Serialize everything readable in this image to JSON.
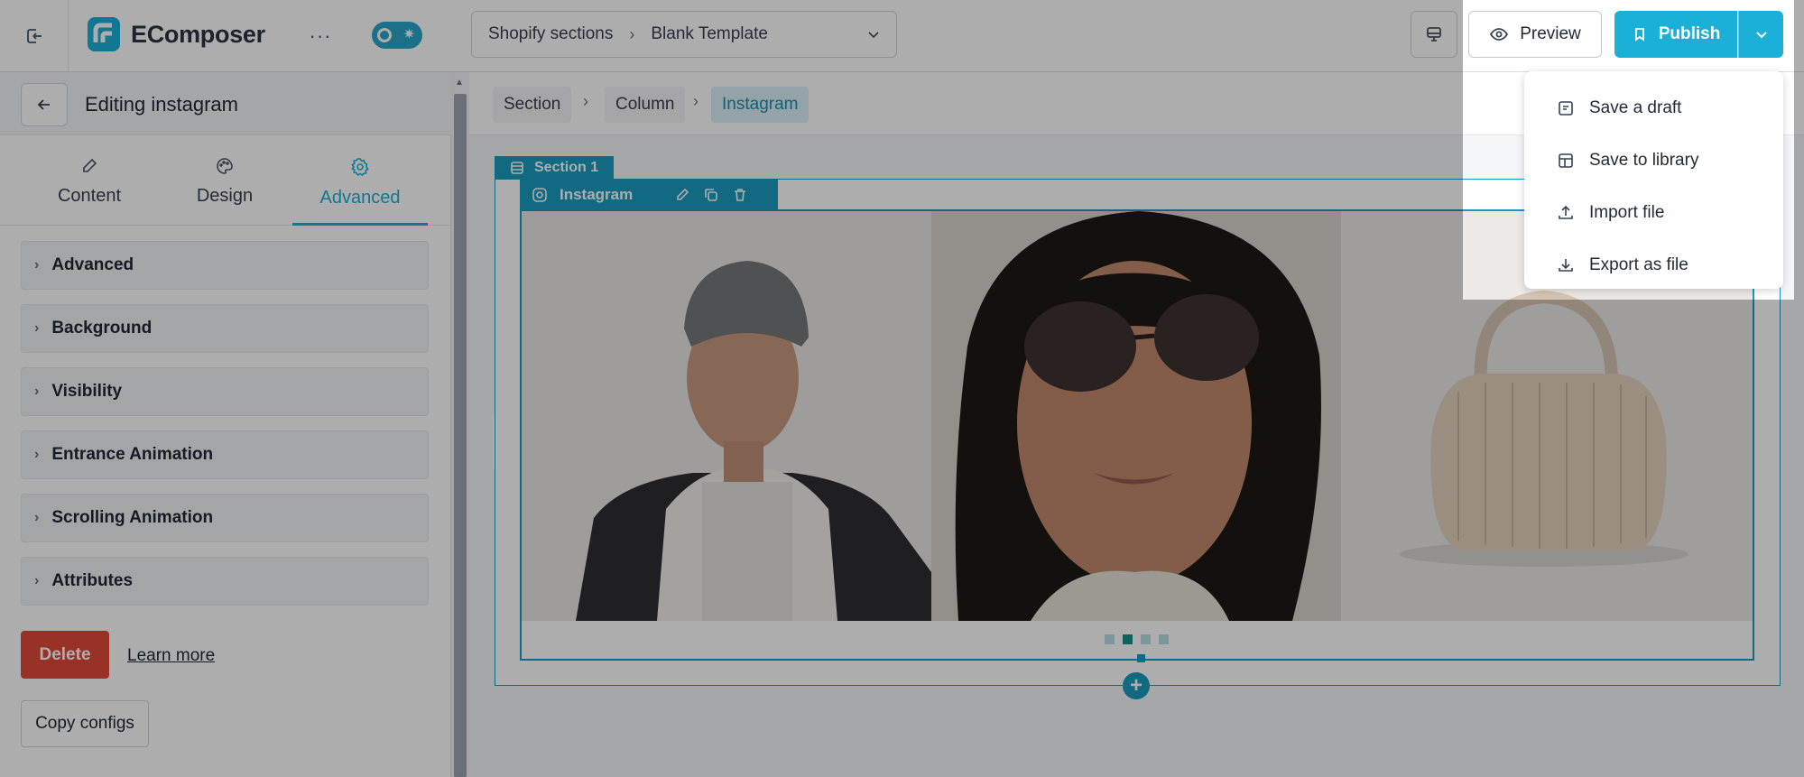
{
  "app": {
    "name": "EComposer"
  },
  "header": {
    "more_label": "···",
    "template_path": [
      "Shopify sections",
      "Blank Template"
    ],
    "preview_label": "Preview",
    "publish_label": "Publish"
  },
  "publish_menu": {
    "items": [
      {
        "label": "Save a draft",
        "icon": "draft-icon"
      },
      {
        "label": "Save to library",
        "icon": "library-icon"
      },
      {
        "label": "Import file",
        "icon": "upload-icon"
      },
      {
        "label": "Export as file",
        "icon": "download-icon"
      }
    ]
  },
  "left_panel": {
    "title": "Editing instagram",
    "tabs": [
      {
        "label": "Content",
        "icon": "pencil-icon"
      },
      {
        "label": "Design",
        "icon": "palette-icon"
      },
      {
        "label": "Advanced",
        "icon": "gear-icon",
        "active": true
      }
    ],
    "sections": [
      "Advanced",
      "Background",
      "Visibility",
      "Entrance Animation",
      "Scrolling Animation",
      "Attributes"
    ],
    "delete_label": "Delete",
    "learn_more_label": "Learn more",
    "copy_label": "Copy configs"
  },
  "canvas": {
    "breadcrumb": [
      "Section",
      "Column",
      "Instagram"
    ],
    "section_label": "Section 1",
    "element_label": "Instagram",
    "carousel_dots": 4,
    "active_dot": 2
  },
  "colors": {
    "accent": "#1ab0d8",
    "selection": "#1a9bc0",
    "delete": "#e04a38"
  }
}
